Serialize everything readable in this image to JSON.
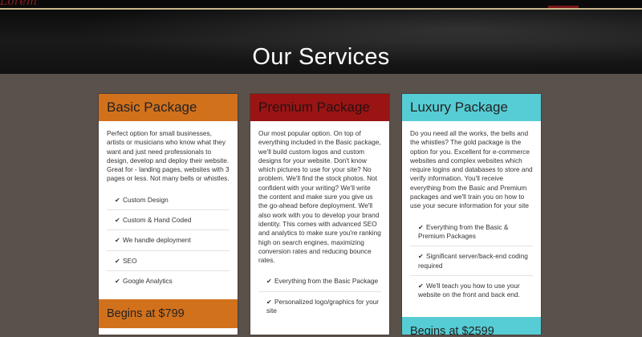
{
  "header": {
    "logo_fragment": "Lorem"
  },
  "hero": {
    "title": "Our Services"
  },
  "packages": [
    {
      "title": "Basic Package",
      "description": "Perfect option for small businesses, artists or musicians who know what they want and just need professionals to design, develop and deploy their website. Great for - landing pages, websites with 3 pages or less. Not many bells or whistles.",
      "features": [
        "Custom Design",
        "Custom & Hand Coded",
        "We handle deployment",
        "SEO",
        "Google Analytics"
      ],
      "price": "Begins at $799"
    },
    {
      "title": "Premium Package",
      "description": "Our most popular option. On top of everything included in the Basic package, we'll build custom logos and custom designs for your website. Don't know which pictures to use for your site? No problem. We'll find the stock photos. Not confident with your writing? We'll write the content and make sure you give us the go-ahead before deployment. We'll also work with you to develop your brand identity. This comes with advanced SEO and analytics to make sure you're ranking high on search engines, maximizing conversion rates and reducing bounce rates.",
      "features": [
        "Everything from the Basic Package",
        "Personalized logo/graphics for your site"
      ]
    },
    {
      "title": "Luxury Package",
      "description": "Do you need all the works, the bells and the whistles? The gold package is the option for you. Excellent for e-commerce websites and complex websites which require logins and databases to store and verify information. You'll receive everything from the Basic and Premium packages and we'll train you on how to use your secure information for your site",
      "features": [
        "Everything from the Basic & Premium Packages",
        "Significant server/back-end coding required",
        "We'll teach you how to use your website on the front and back end."
      ],
      "price": "Begins at $2599"
    }
  ],
  "check_icon": "✔",
  "colors": {
    "basic": "#d2711c",
    "premium": "#9a1414",
    "luxury": "#56ccd4",
    "background": "#5b514b"
  }
}
